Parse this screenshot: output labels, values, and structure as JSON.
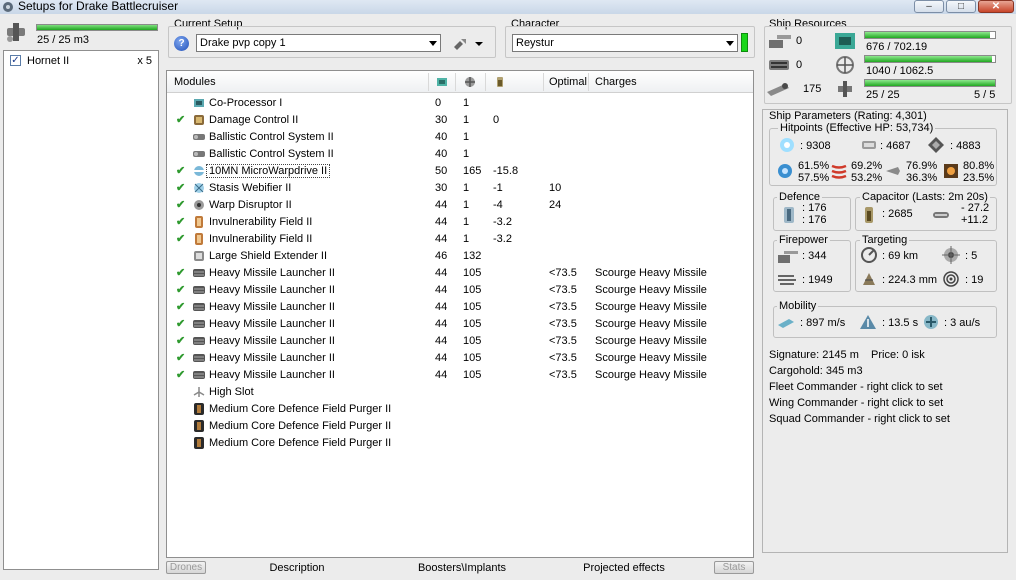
{
  "window": {
    "title": "Setups for Drake Battlecruiser",
    "min_label": "–",
    "max_label": "□",
    "close_label": "✕"
  },
  "drones": {
    "bay_text": "25 / 25 m3",
    "bay_fill": 1.0,
    "items": [
      {
        "checked": true,
        "name": "Hornet II",
        "count": "x 5"
      }
    ]
  },
  "setup": {
    "current_label": "Current Setup",
    "current_value": "Drake pvp copy 1",
    "character_label": "Character",
    "character_value": "Reystur"
  },
  "modules": {
    "headers": {
      "modules": "Modules",
      "optimal": "Optimal",
      "charges": "Charges"
    },
    "rows": [
      {
        "checked": false,
        "icon": "co-processor-icon",
        "name": "Co-Processor I",
        "c1": "0",
        "c2": "1",
        "c3": "",
        "c4": "",
        "c5": ""
      },
      {
        "checked": true,
        "icon": "damage-control-icon",
        "name": "Damage Control II",
        "c1": "30",
        "c2": "1",
        "c3": "0",
        "c4": "",
        "c5": ""
      },
      {
        "checked": false,
        "icon": "ballistic-control-icon",
        "name": "Ballistic Control System II",
        "c1": "40",
        "c2": "1",
        "c3": "",
        "c4": "",
        "c5": ""
      },
      {
        "checked": false,
        "icon": "ballistic-control-icon",
        "name": "Ballistic Control System II",
        "c1": "40",
        "c2": "1",
        "c3": "",
        "c4": "",
        "c5": ""
      },
      {
        "checked": true,
        "icon": "microwarpdrive-icon",
        "name": "10MN MicroWarpdrive II",
        "c1": "50",
        "c2": "165",
        "c3": "-15.8",
        "c4": "",
        "c5": ""
      },
      {
        "checked": true,
        "icon": "stasis-webifier-icon",
        "name": "Stasis Webifier II",
        "c1": "30",
        "c2": "1",
        "c3": "-1",
        "c4": "10",
        "c5": ""
      },
      {
        "checked": true,
        "icon": "warp-disruptor-icon",
        "name": "Warp Disruptor II",
        "c1": "44",
        "c2": "1",
        "c3": "-4",
        "c4": "24",
        "c5": ""
      },
      {
        "checked": true,
        "icon": "invulnerability-field-icon",
        "name": "Invulnerability Field II",
        "c1": "44",
        "c2": "1",
        "c3": "-3.2",
        "c4": "",
        "c5": ""
      },
      {
        "checked": true,
        "icon": "invulnerability-field-icon",
        "name": "Invulnerability Field II",
        "c1": "44",
        "c2": "1",
        "c3": "-3.2",
        "c4": "",
        "c5": ""
      },
      {
        "checked": false,
        "icon": "shield-extender-icon",
        "name": "Large Shield Extender II",
        "c1": "46",
        "c2": "132",
        "c3": "",
        "c4": "",
        "c5": ""
      },
      {
        "checked": true,
        "icon": "missile-launcher-icon",
        "name": "Heavy Missile Launcher II",
        "c1": "44",
        "c2": "105",
        "c3": "",
        "c4": "<73.5",
        "c5": "Scourge Heavy Missile"
      },
      {
        "checked": true,
        "icon": "missile-launcher-icon",
        "name": "Heavy Missile Launcher II",
        "c1": "44",
        "c2": "105",
        "c3": "",
        "c4": "<73.5",
        "c5": "Scourge Heavy Missile"
      },
      {
        "checked": true,
        "icon": "missile-launcher-icon",
        "name": "Heavy Missile Launcher II",
        "c1": "44",
        "c2": "105",
        "c3": "",
        "c4": "<73.5",
        "c5": "Scourge Heavy Missile"
      },
      {
        "checked": true,
        "icon": "missile-launcher-icon",
        "name": "Heavy Missile Launcher II",
        "c1": "44",
        "c2": "105",
        "c3": "",
        "c4": "<73.5",
        "c5": "Scourge Heavy Missile"
      },
      {
        "checked": true,
        "icon": "missile-launcher-icon",
        "name": "Heavy Missile Launcher II",
        "c1": "44",
        "c2": "105",
        "c3": "",
        "c4": "<73.5",
        "c5": "Scourge Heavy Missile"
      },
      {
        "checked": true,
        "icon": "missile-launcher-icon",
        "name": "Heavy Missile Launcher II",
        "c1": "44",
        "c2": "105",
        "c3": "",
        "c4": "<73.5",
        "c5": "Scourge Heavy Missile"
      },
      {
        "checked": true,
        "icon": "missile-launcher-icon",
        "name": "Heavy Missile Launcher II",
        "c1": "44",
        "c2": "105",
        "c3": "",
        "c4": "<73.5",
        "c5": "Scourge Heavy Missile"
      },
      {
        "checked": false,
        "icon": "high-slot-icon",
        "name": "High Slot",
        "c1": "",
        "c2": "",
        "c3": "",
        "c4": "",
        "c5": ""
      },
      {
        "checked": false,
        "icon": "rig-icon",
        "name": "Medium Core Defence Field Purger II",
        "c1": "",
        "c2": "",
        "c3": "",
        "c4": "",
        "c5": ""
      },
      {
        "checked": false,
        "icon": "rig-icon",
        "name": "Medium Core Defence Field Purger II",
        "c1": "",
        "c2": "",
        "c3": "",
        "c4": "",
        "c5": ""
      },
      {
        "checked": false,
        "icon": "rig-icon",
        "name": "Medium Core Defence Field Purger II",
        "c1": "",
        "c2": "",
        "c3": "",
        "c4": "",
        "c5": ""
      }
    ]
  },
  "tabs": {
    "drones": "Drones",
    "description": "Description",
    "boosters": "Boosters\\Implants",
    "projected": "Projected effects",
    "stats": "Stats"
  },
  "resources": {
    "title": "Ship Resources",
    "turrets": "0",
    "launchers": "0",
    "calibration": "175",
    "cpu": "676 / 702.19",
    "cpu_fill": 0.963,
    "powergrid": "1040 / 1062.5",
    "powergrid_fill": 0.979,
    "drone_bandwidth": "25 / 25",
    "drone_fill": 1.0,
    "drones_active": "5 / 5"
  },
  "params": {
    "title": "Ship Parameters (Rating: 4,301)",
    "hitpoints_label": "Hitpoints (Effective HP: 53,734)",
    "shield_hp": ": 9308",
    "armor_hp": ": 4687",
    "structure_hp": ": 4883",
    "res": {
      "em_shield": "61.5%",
      "em_armor": "57.5%",
      "thermal_shield": "69.2%",
      "thermal_armor": "53.2%",
      "kinetic_shield": "76.9%",
      "kinetic_armor": "36.3%",
      "explosive_shield": "80.8%",
      "explosive_armor": "23.5%"
    },
    "defence_label": "Defence",
    "defence_1": ": 176",
    "defence_2": ": 176",
    "capacitor_label": "Capacitor (Lasts: 2m 20s)",
    "capacitor_value": ": 2685",
    "cap_1": "- 27.2",
    "cap_2": "+11.2",
    "firepower_label": "Firepower",
    "firepower_1": ": 344",
    "firepower_2": ": 1949",
    "targeting_label": "Targeting",
    "targeting_range": ": 69 km",
    "targets": ": 5",
    "scan_res": ": 224.3 mm",
    "sensor": ": 19",
    "mobility_label": "Mobility",
    "speed": ": 897 m/s",
    "align": ": 13.5 s",
    "warp": ": 3 au/s",
    "signature": "Signature: 2145 m",
    "price": "Price: 0 isk",
    "cargohold": "Cargohold: 345 m3",
    "fleet": "Fleet Commander - right click to set",
    "wing": "Wing Commander - right click to set",
    "squad": "Squad Commander - right click to set"
  }
}
